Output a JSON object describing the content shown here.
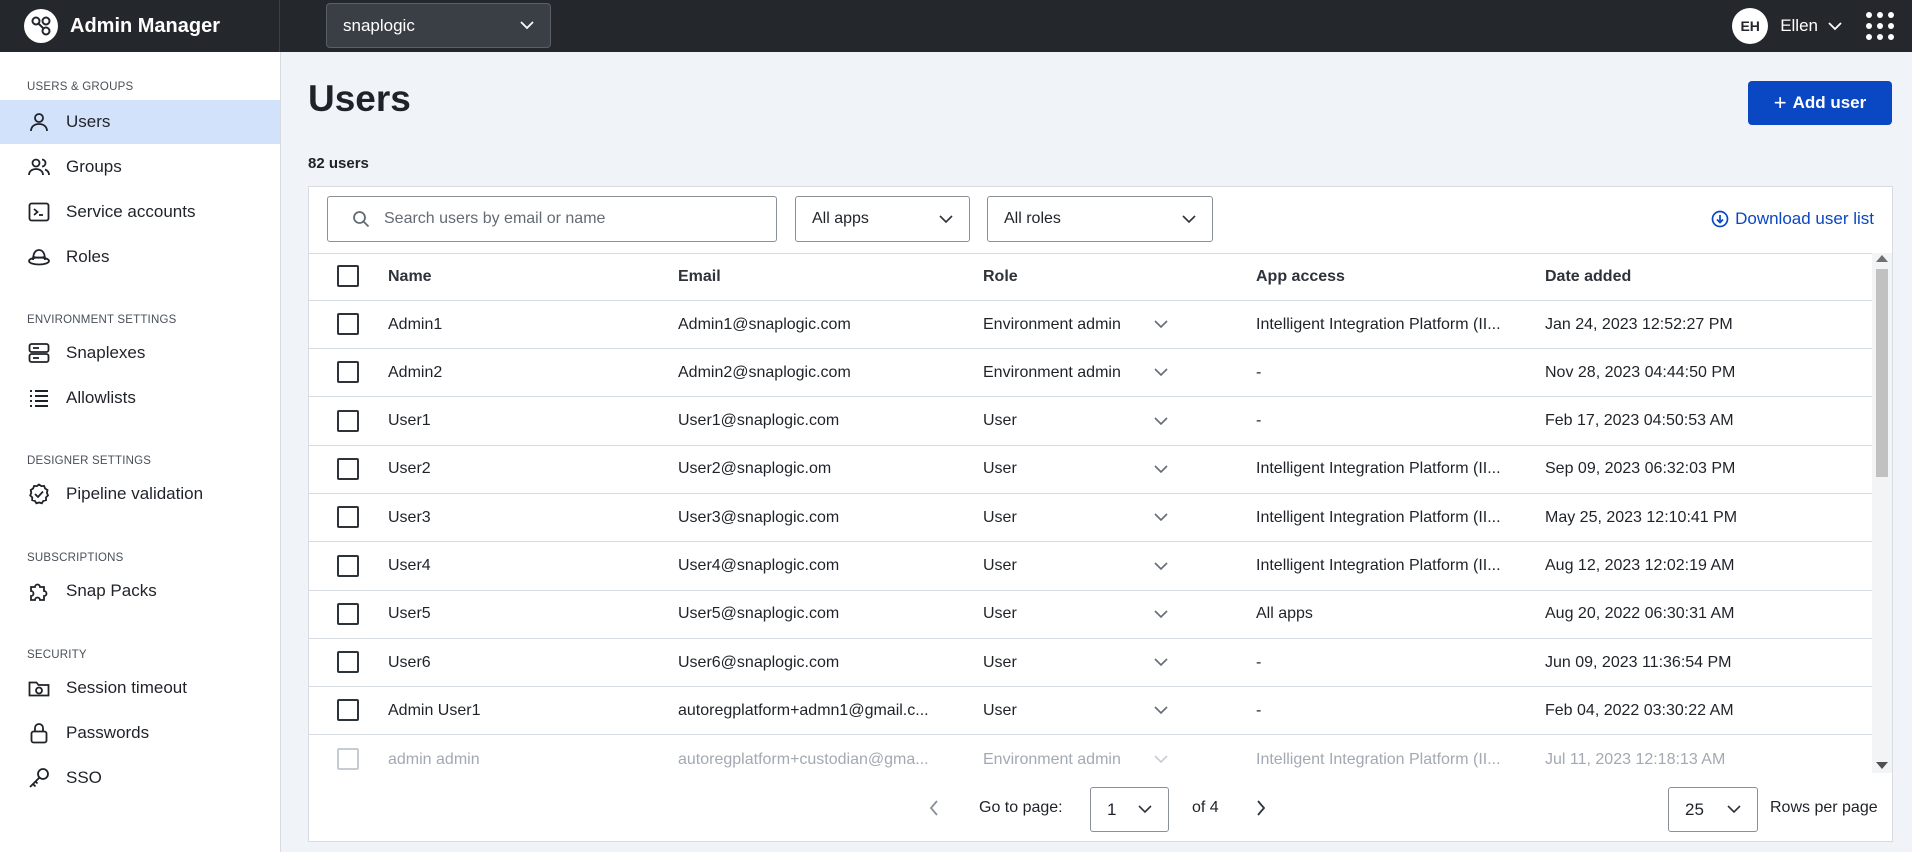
{
  "app": {
    "name": "Admin Manager",
    "environment": "snaplogic",
    "user_initials": "EH",
    "user_name": "Ellen"
  },
  "sidebar": {
    "sections": [
      {
        "title": "USERS & GROUPS"
      },
      {
        "title": "ENVIRONMENT SETTINGS"
      },
      {
        "title": "DESIGNER SETTINGS"
      },
      {
        "title": "SUBSCRIPTIONS"
      },
      {
        "title": "SECURITY"
      }
    ],
    "items": [
      {
        "label": "Users",
        "icon": "user-icon",
        "active": true
      },
      {
        "label": "Groups",
        "icon": "groups-icon"
      },
      {
        "label": "Service accounts",
        "icon": "terminal-icon"
      },
      {
        "label": "Roles",
        "icon": "hat-icon"
      },
      {
        "label": "Snaplexes",
        "icon": "server-icon"
      },
      {
        "label": "Allowlists",
        "icon": "list-icon"
      },
      {
        "label": "Pipeline validation",
        "icon": "check-circle-icon"
      },
      {
        "label": "Snap Packs",
        "icon": "puzzle-icon"
      },
      {
        "label": "Session timeout",
        "icon": "camera-folder-icon"
      },
      {
        "label": "Passwords",
        "icon": "lock-icon"
      },
      {
        "label": "SSO",
        "icon": "key-icon"
      }
    ]
  },
  "main": {
    "title": "Users",
    "add_user_label": "Add user",
    "count": "82 users",
    "search_placeholder": "Search users by email or name",
    "apps_filter": "All apps",
    "roles_filter": "All roles",
    "download_label": "Download user list",
    "columns": [
      "Name",
      "Email",
      "Role",
      "App access",
      "Date added"
    ],
    "rows": [
      {
        "name": "Admin1",
        "email": "Admin1@snaplogic.com",
        "role": "Environment admin",
        "app": "Intelligent Integration Platform (II...",
        "date": "Jan 24, 2023 12:52:27 PM"
      },
      {
        "name": "Admin2",
        "email": "Admin2@snaplogic.com",
        "role": "Environment admin",
        "app": "-",
        "date": "Nov 28, 2023 04:44:50 PM"
      },
      {
        "name": "User1",
        "email": "User1@snaplogic.com",
        "role": "User",
        "app": "-",
        "date": "Feb 17, 2023 04:50:53 AM"
      },
      {
        "name": "User2",
        "email": "User2@snaplogic.om",
        "role": "User",
        "app": "Intelligent Integration Platform (II...",
        "date": "Sep 09, 2023 06:32:03 PM"
      },
      {
        "name": "User3",
        "email": "User3@snaplogic.com",
        "role": "User",
        "app": "Intelligent Integration Platform (II...",
        "date": "May 25, 2023 12:10:41 PM"
      },
      {
        "name": "User4",
        "email": "User4@snaplogic.com",
        "role": "User",
        "app": "Intelligent Integration Platform (II...",
        "date": "Aug 12, 2023 12:02:19 AM"
      },
      {
        "name": "User5",
        "email": "User5@snaplogic.com",
        "role": "User",
        "app": "All apps",
        "date": "Aug 20, 2022 06:30:31 AM"
      },
      {
        "name": "User6",
        "email": "User6@snaplogic.com",
        "role": "User",
        "app": "-",
        "date": "Jun 09, 2023 11:36:54 PM"
      },
      {
        "name": "Admin User1",
        "email": "autoregplatform+admn1@gmail.c...",
        "role": "User",
        "app": "-",
        "date": "Feb 04, 2022 03:30:22 AM"
      },
      {
        "name": "admin admin",
        "email": "autoregplatform+custodian@gma...",
        "role": "Environment admin",
        "app": "Intelligent Integration Platform (II...",
        "date": "Jul 11, 2023 12:18:13 AM"
      }
    ],
    "pagination": {
      "go_to_label": "Go to page:",
      "current_page": "1",
      "of_label": "of 4",
      "rows_per_page": "25",
      "rows_per_page_label": "Rows per page"
    }
  },
  "colors": {
    "topbar": "#24272c",
    "primary": "#0a47c2",
    "active_nav": "#d3e2fb"
  }
}
